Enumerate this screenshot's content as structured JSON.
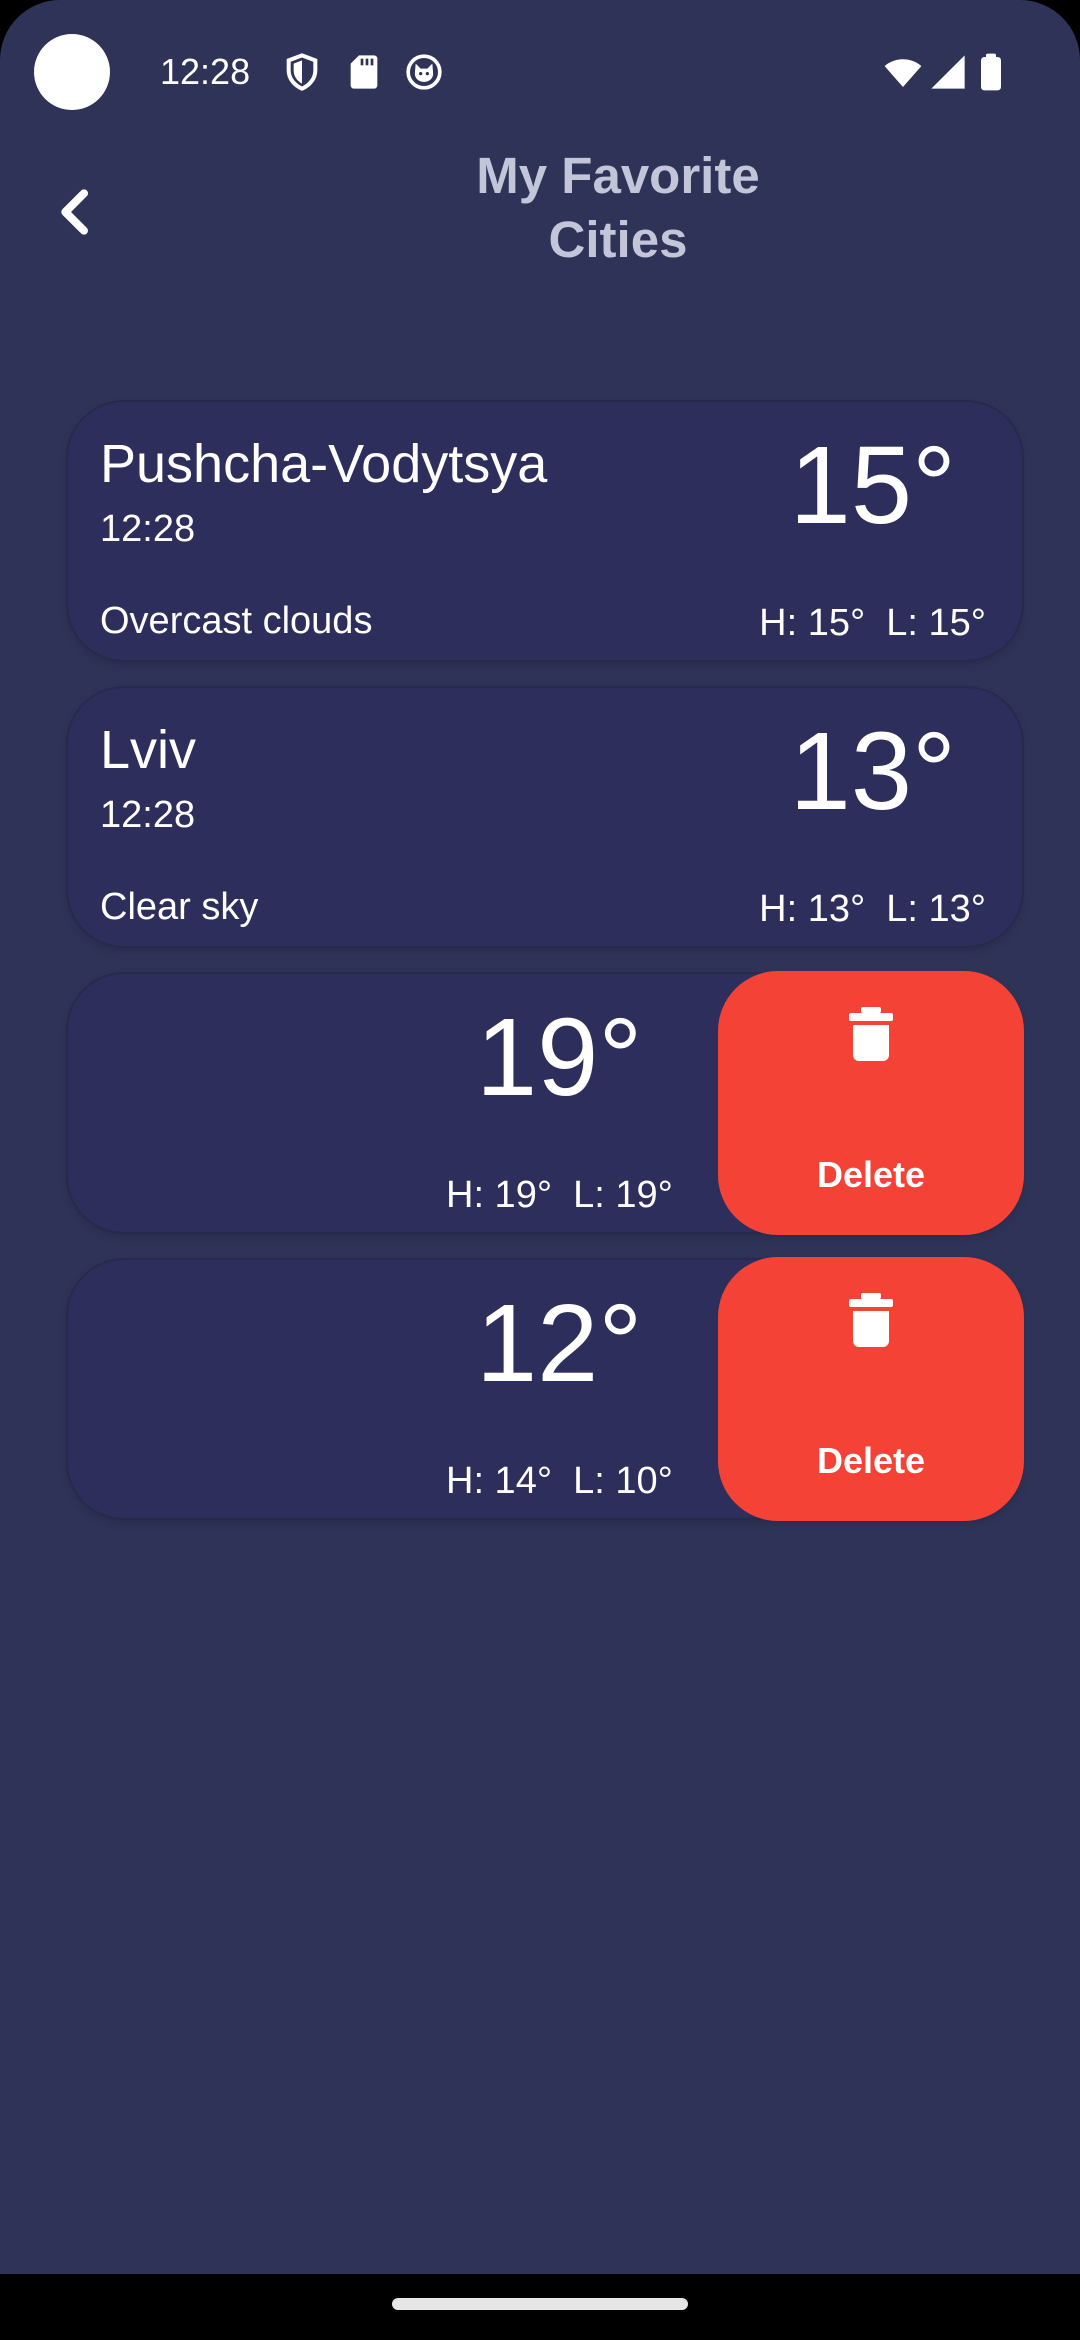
{
  "status_bar": {
    "time": "12:28",
    "icons": [
      "shield-icon",
      "sd-card-icon",
      "cat-face-icon",
      "wifi-icon",
      "signal-icon",
      "battery-icon"
    ]
  },
  "header": {
    "title": "My Favorite\nCities",
    "back_icon": "chevron-left-icon"
  },
  "cities": [
    {
      "name": "Pushcha-Vodytsya",
      "time": "12:28",
      "description": "Overcast clouds",
      "temp": "15°",
      "high_low": "H: 15°  L: 15°"
    },
    {
      "name": "Lviv",
      "time": "12:28",
      "description": "Clear sky",
      "temp": "13°",
      "high_low": "H: 13°  L: 13°"
    },
    {
      "temp": "19°",
      "high_low": "H: 19°  L: 19°",
      "delete_label": "Delete"
    },
    {
      "temp": "12°",
      "high_low": "H: 14°  L: 10°",
      "delete_label": "Delete"
    }
  ],
  "colors": {
    "background": "#2f3358",
    "card": "#2e2e5c",
    "delete": "#f44336",
    "title": "#c3c5d8"
  }
}
